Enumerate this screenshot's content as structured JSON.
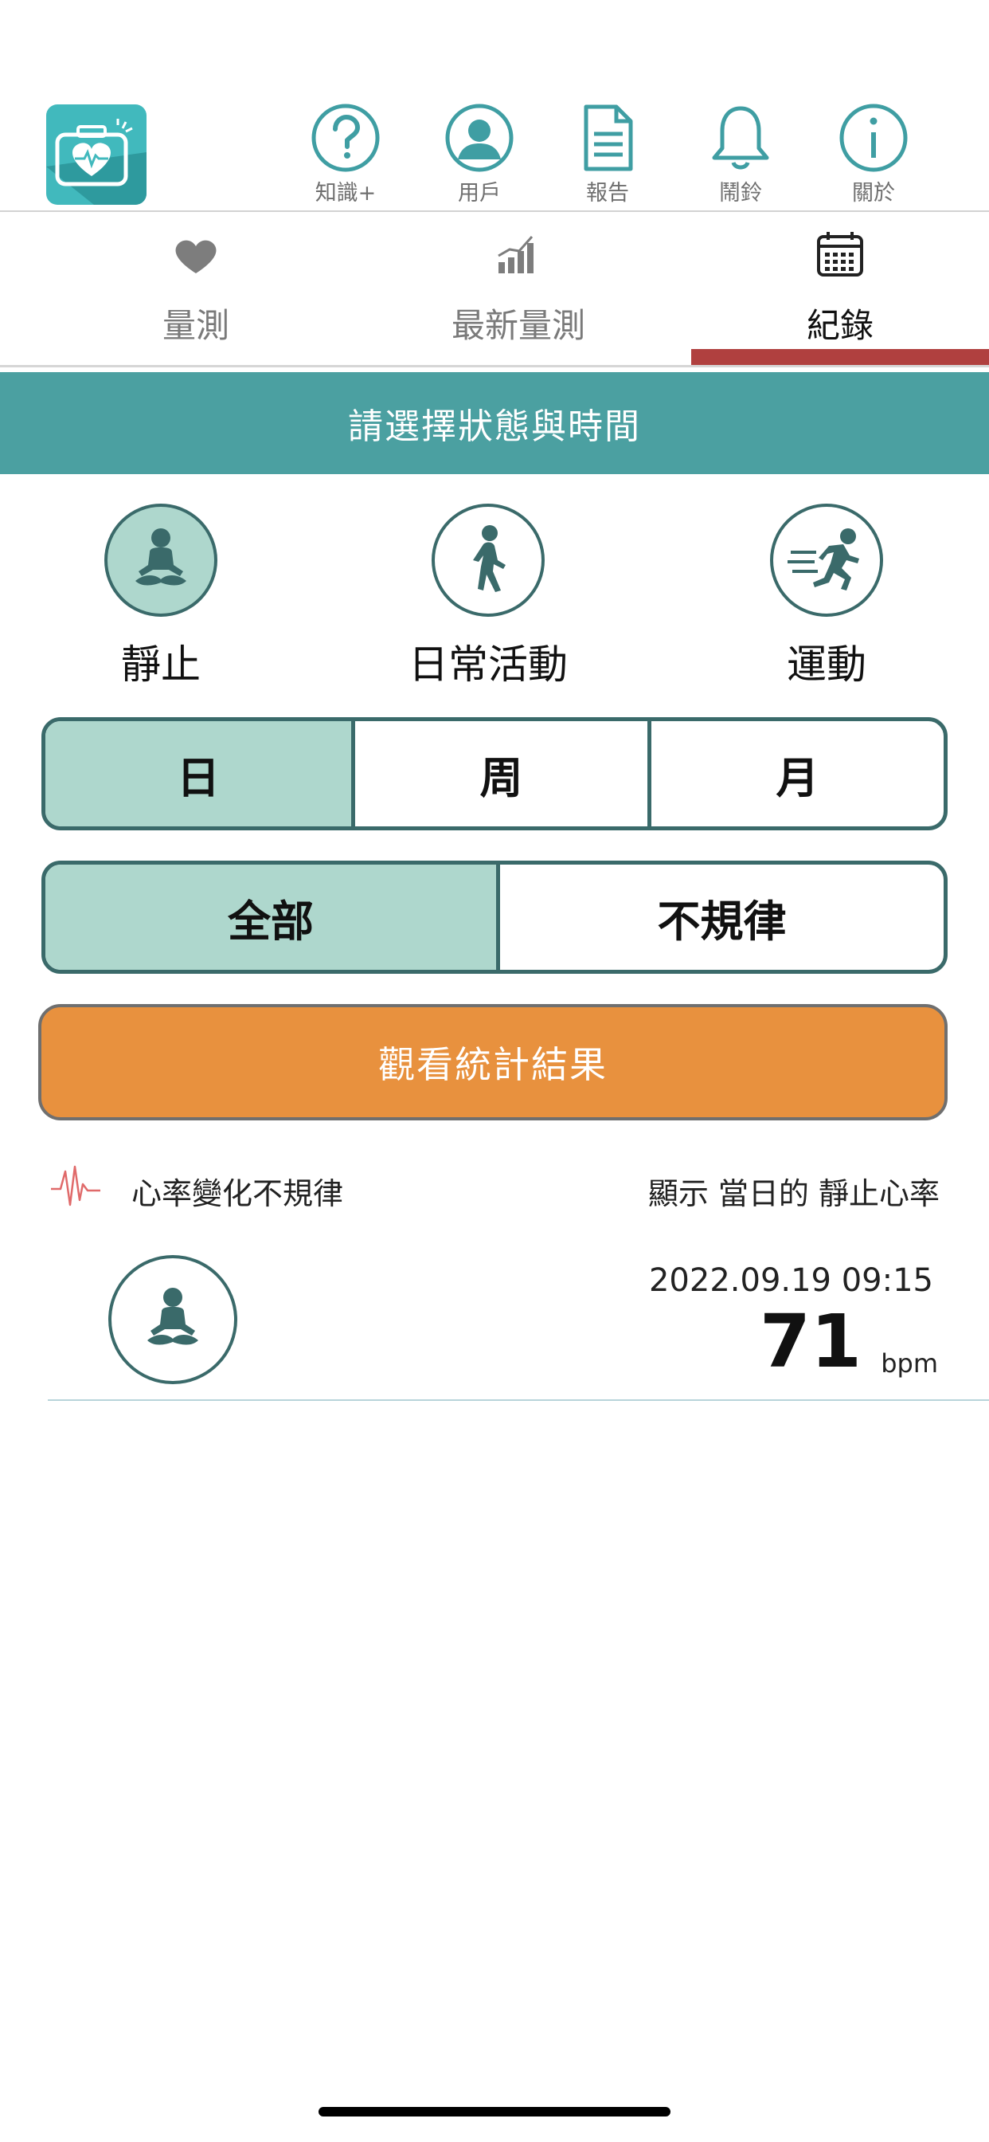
{
  "top_nav": {
    "items": [
      {
        "label": "知識+",
        "icon": "question-icon"
      },
      {
        "label": "用戶",
        "icon": "user-icon"
      },
      {
        "label": "報告",
        "icon": "report-icon"
      },
      {
        "label": "鬧鈴",
        "icon": "bell-icon"
      },
      {
        "label": "關於",
        "icon": "info-icon"
      }
    ]
  },
  "tabs": [
    {
      "label": "量測",
      "icon": "heart-icon",
      "active": false
    },
    {
      "label": "最新量測",
      "icon": "chart-icon",
      "active": false
    },
    {
      "label": "紀錄",
      "icon": "calendar-icon",
      "active": true
    }
  ],
  "banner": {
    "title": "請選擇狀態與時間"
  },
  "states": [
    {
      "label": "靜止",
      "icon": "meditation-icon",
      "selected": true
    },
    {
      "label": "日常活動",
      "icon": "walking-icon",
      "selected": false
    },
    {
      "label": "運動",
      "icon": "running-icon",
      "selected": false
    }
  ],
  "period": {
    "options": [
      "日",
      "周",
      "月"
    ],
    "selected": "日"
  },
  "rhythm": {
    "options": [
      "全部",
      "不規律"
    ],
    "selected": "全部"
  },
  "view_button": {
    "label": "觀看統計結果"
  },
  "legend": {
    "label": "心率變化不規律"
  },
  "filter": {
    "label": "顯示 當日的 靜止心率"
  },
  "records": [
    {
      "datetime": "2022.09.19 09:15",
      "value": "71",
      "unit": "bpm",
      "icon": "meditation-icon"
    }
  ],
  "colors": {
    "teal": "#4ba0a1",
    "selected_fill": "#aed7cd",
    "border_dark": "#3a6a6a",
    "accent_red": "#b0403f",
    "orange": "#e8913e",
    "logo": "#41b9bd",
    "irregular": "#e06a6a"
  }
}
